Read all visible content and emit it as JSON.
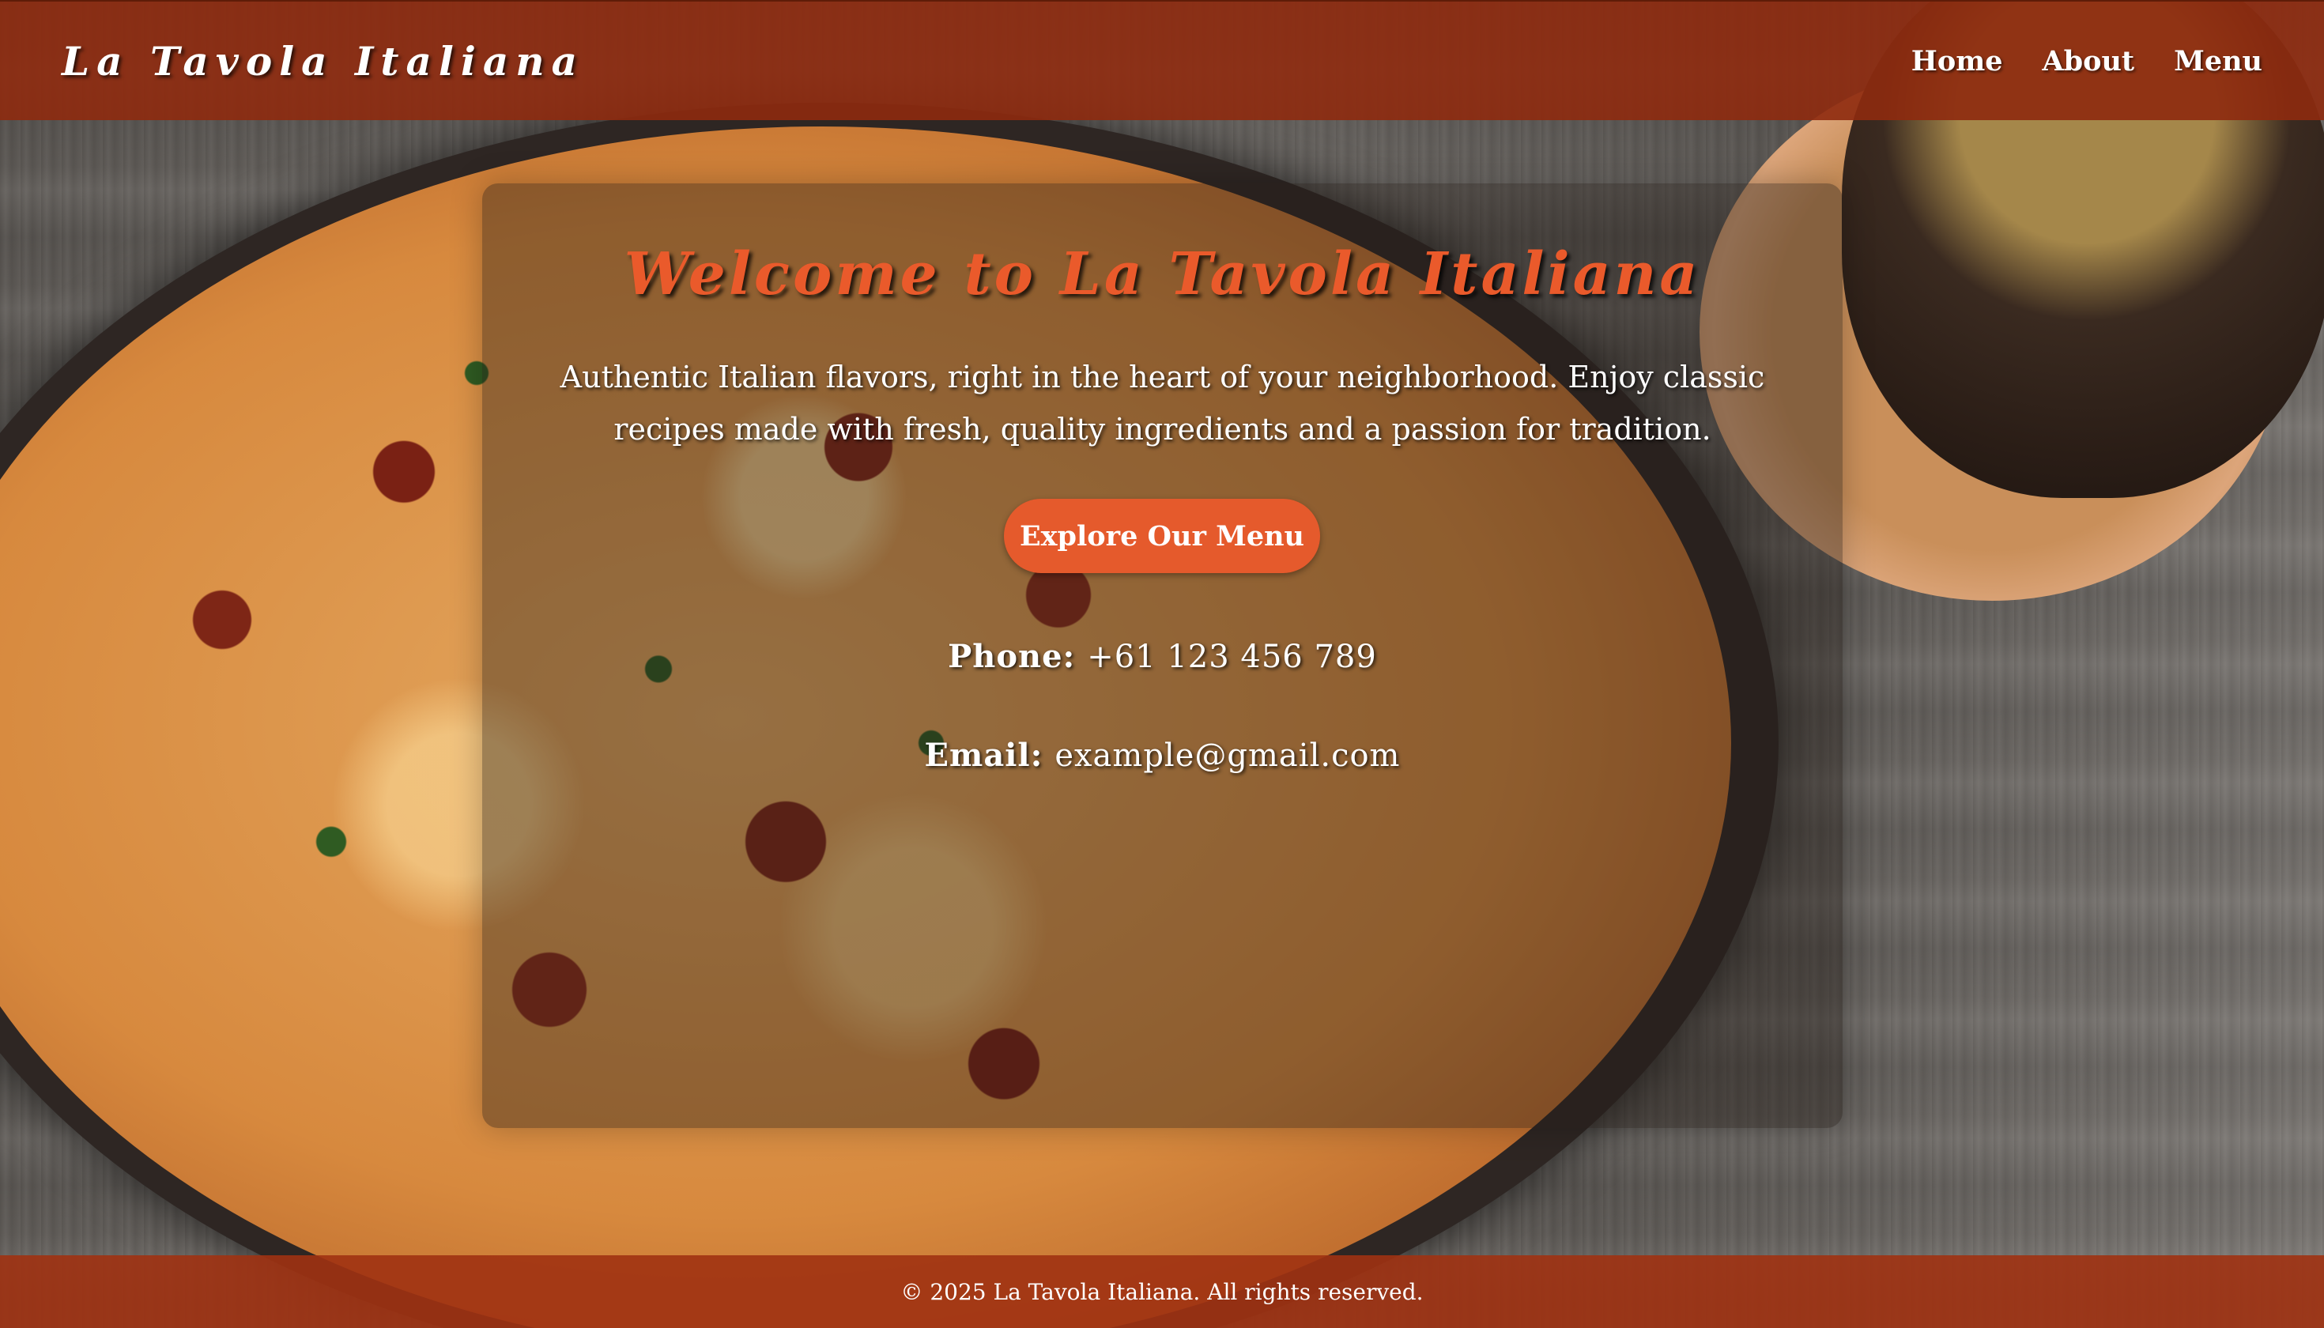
{
  "header": {
    "brand": "La Tavola Italiana",
    "nav": [
      "Home",
      "About",
      "Menu"
    ]
  },
  "hero": {
    "title": "Welcome to La Tavola Italiana",
    "description": "Authentic Italian flavors, right in the heart of your neighborhood. Enjoy classic recipes made with fresh, quality ingredients and a passion for tradition.",
    "cta_label": "Explore Our Menu"
  },
  "contact": {
    "phone_label": "Phone:",
    "phone_value": "+61 123 456 789",
    "email_label": "Email:",
    "email_value": "example@gmail.com"
  },
  "footer": {
    "text": "© 2025 La Tavola Italiana. All rights reserved."
  },
  "colors": {
    "header_bg": "#8e2a0e",
    "accent": "#e55a2c",
    "title": "#ea5a2b",
    "text": "#ffffff"
  }
}
